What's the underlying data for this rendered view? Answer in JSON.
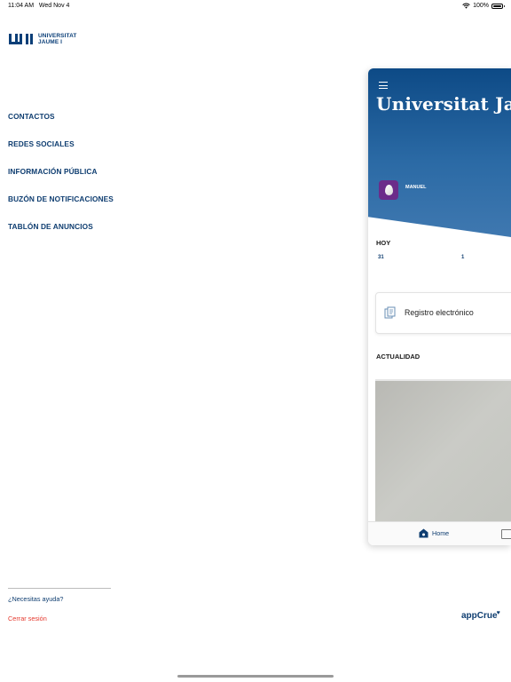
{
  "status_bar": {
    "time": "11:04 AM",
    "date": "Wed Nov 4",
    "battery": "100%"
  },
  "logo": {
    "line1": "UNIVERSITAT",
    "line2": "JAUME I",
    "mark": "UJI"
  },
  "menu": [
    {
      "label": "CONTACTOS"
    },
    {
      "label": "REDES SOCIALES"
    },
    {
      "label": "INFORMACIÓN PÚBLICA"
    },
    {
      "label": "BUZÓN DE NOTIFICACIONES"
    },
    {
      "label": "TABLÓN DE ANUNCIOS"
    }
  ],
  "footer": {
    "help": "¿Necesitas ayuda?",
    "logout": "Cerrar sesión",
    "brand": "appCrue"
  },
  "panel": {
    "title": "Universitat Jaume I",
    "user": "MANUEL",
    "today_label": "HOY",
    "days": [
      "31",
      "1"
    ],
    "card_label": "Registro electrónico",
    "news_label": "ACTUALIDAD",
    "tab_home": "Home"
  },
  "colors": {
    "primary": "#0e3d70",
    "logout": "#e53a2f",
    "hero_top": "#0d4a86",
    "avatar": "#6b2c8a"
  }
}
